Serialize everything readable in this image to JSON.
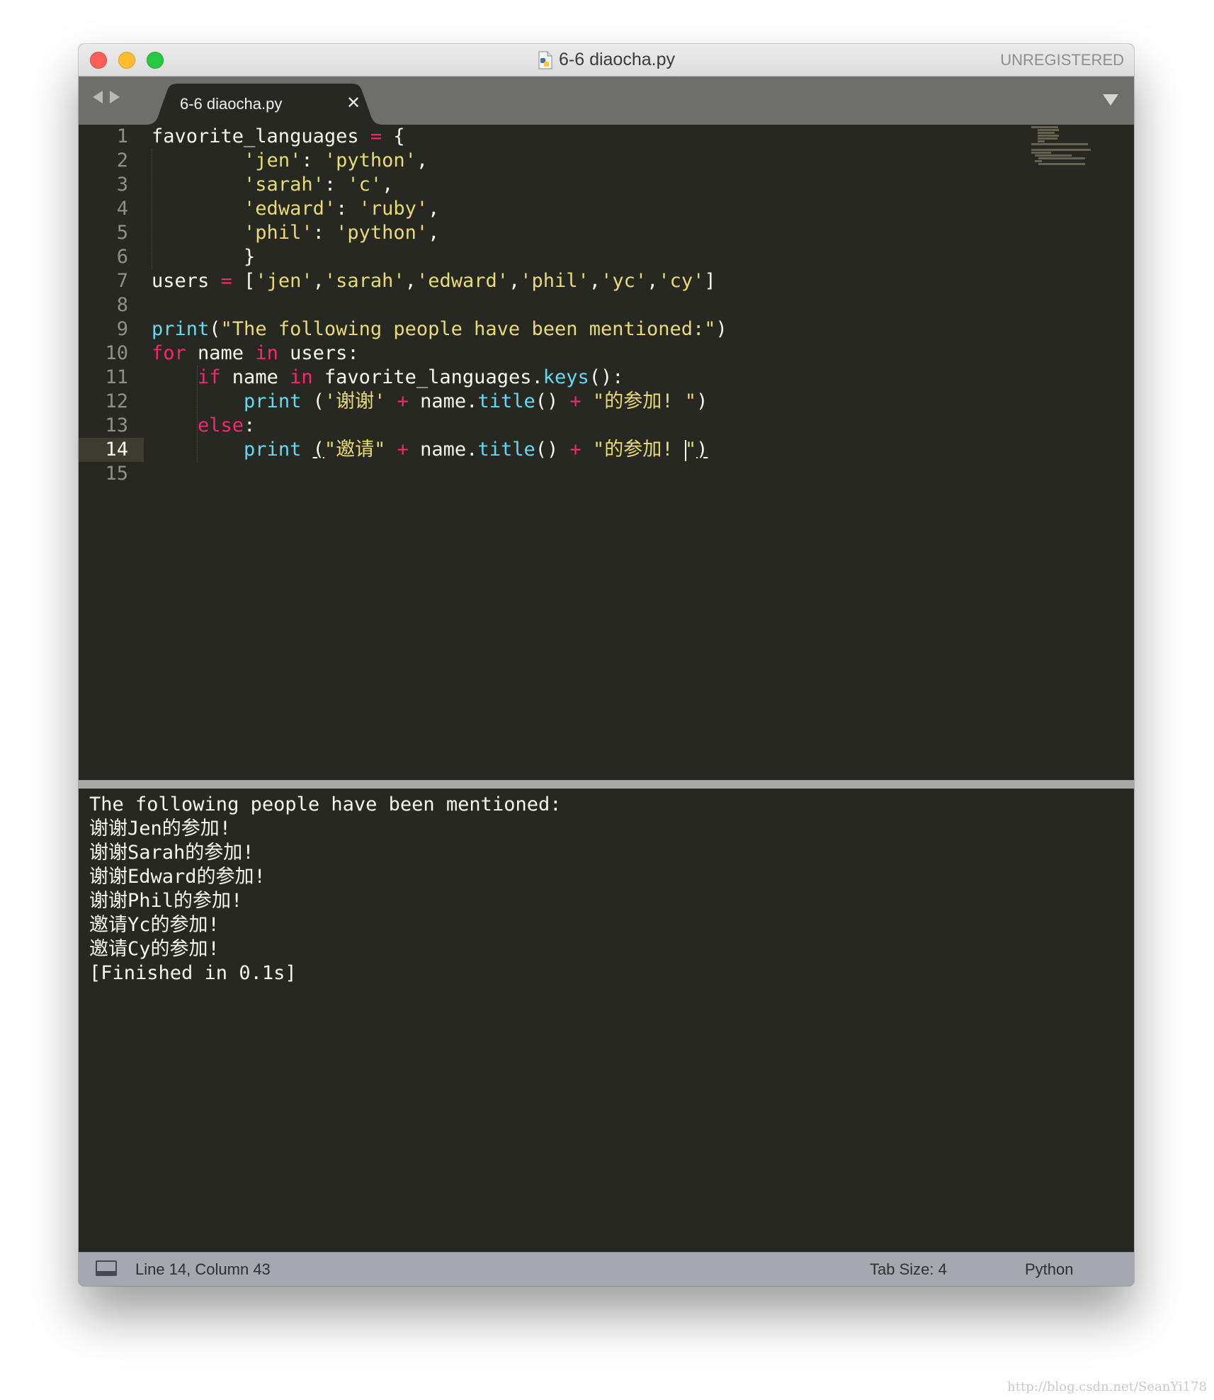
{
  "window": {
    "title": "6-6 diaocha.py",
    "registration": "UNREGISTERED"
  },
  "tabs": [
    {
      "label": "6-6 diaocha.py",
      "close_glyph": "✕",
      "active": true
    }
  ],
  "icons": {
    "file": "python-file-icon",
    "nav_back": "arrow-left-icon",
    "nav_forward": "arrow-right-icon",
    "tab_close": "close-icon",
    "tab_menu": "triangle-down-icon",
    "panel_toggle": "panel-icon"
  },
  "editor": {
    "line_numbers": [
      "1",
      "2",
      "3",
      "4",
      "5",
      "6",
      "7",
      "8",
      "9",
      "10",
      "11",
      "12",
      "13",
      "14",
      "15"
    ],
    "active_line": 14,
    "lines": [
      [
        {
          "t": "favorite_languages ",
          "c": "p"
        },
        {
          "t": "=",
          "c": "op"
        },
        {
          "t": " {",
          "c": "p"
        }
      ],
      [
        {
          "t": "        ",
          "c": "p"
        },
        {
          "t": "'jen'",
          "c": "str"
        },
        {
          "t": ": ",
          "c": "p"
        },
        {
          "t": "'python'",
          "c": "str"
        },
        {
          "t": ",",
          "c": "p"
        }
      ],
      [
        {
          "t": "        ",
          "c": "p"
        },
        {
          "t": "'sarah'",
          "c": "str"
        },
        {
          "t": ": ",
          "c": "p"
        },
        {
          "t": "'c'",
          "c": "str"
        },
        {
          "t": ",",
          "c": "p"
        }
      ],
      [
        {
          "t": "        ",
          "c": "p"
        },
        {
          "t": "'edward'",
          "c": "str"
        },
        {
          "t": ": ",
          "c": "p"
        },
        {
          "t": "'ruby'",
          "c": "str"
        },
        {
          "t": ",",
          "c": "p"
        }
      ],
      [
        {
          "t": "        ",
          "c": "p"
        },
        {
          "t": "'phil'",
          "c": "str"
        },
        {
          "t": ": ",
          "c": "p"
        },
        {
          "t": "'python'",
          "c": "str"
        },
        {
          "t": ",",
          "c": "p"
        }
      ],
      [
        {
          "t": "        }",
          "c": "p"
        }
      ],
      [
        {
          "t": "users ",
          "c": "p"
        },
        {
          "t": "=",
          "c": "op"
        },
        {
          "t": " [",
          "c": "p"
        },
        {
          "t": "'jen'",
          "c": "str"
        },
        {
          "t": ",",
          "c": "p"
        },
        {
          "t": "'sarah'",
          "c": "str"
        },
        {
          "t": ",",
          "c": "p"
        },
        {
          "t": "'edward'",
          "c": "str"
        },
        {
          "t": ",",
          "c": "p"
        },
        {
          "t": "'phil'",
          "c": "str"
        },
        {
          "t": ",",
          "c": "p"
        },
        {
          "t": "'yc'",
          "c": "str"
        },
        {
          "t": ",",
          "c": "p"
        },
        {
          "t": "'cy'",
          "c": "str"
        },
        {
          "t": "]",
          "c": "p"
        }
      ],
      [],
      [
        {
          "t": "print",
          "c": "fn"
        },
        {
          "t": "(",
          "c": "p"
        },
        {
          "t": "\"The following people have been mentioned:\"",
          "c": "str"
        },
        {
          "t": ")",
          "c": "p"
        }
      ],
      [
        {
          "t": "for",
          "c": "kw"
        },
        {
          "t": " name ",
          "c": "p"
        },
        {
          "t": "in",
          "c": "kw"
        },
        {
          "t": " users:",
          "c": "p"
        }
      ],
      [
        {
          "t": "    ",
          "c": "p"
        },
        {
          "t": "if",
          "c": "kw"
        },
        {
          "t": " name ",
          "c": "p"
        },
        {
          "t": "in",
          "c": "kw"
        },
        {
          "t": " favorite_languages.",
          "c": "p"
        },
        {
          "t": "keys",
          "c": "fn"
        },
        {
          "t": "():",
          "c": "p"
        }
      ],
      [
        {
          "t": "        ",
          "c": "p"
        },
        {
          "t": "print",
          "c": "fn"
        },
        {
          "t": " (",
          "c": "p"
        },
        {
          "t": "'谢谢'",
          "c": "str"
        },
        {
          "t": " ",
          "c": "p"
        },
        {
          "t": "+",
          "c": "op"
        },
        {
          "t": " name.",
          "c": "p"
        },
        {
          "t": "title",
          "c": "fn"
        },
        {
          "t": "() ",
          "c": "p"
        },
        {
          "t": "+",
          "c": "op"
        },
        {
          "t": " ",
          "c": "p"
        },
        {
          "t": "\"的参加! \"",
          "c": "str"
        },
        {
          "t": ")",
          "c": "p"
        }
      ],
      [
        {
          "t": "    ",
          "c": "p"
        },
        {
          "t": "else",
          "c": "kw"
        },
        {
          "t": ":",
          "c": "p"
        }
      ],
      [
        {
          "t": "        ",
          "c": "p"
        },
        {
          "t": "print",
          "c": "fn"
        },
        {
          "t": " ",
          "c": "p"
        },
        {
          "t": "(",
          "c": "bu"
        },
        {
          "t": "\"邀请\"",
          "c": "str"
        },
        {
          "t": " ",
          "c": "p"
        },
        {
          "t": "+",
          "c": "op"
        },
        {
          "t": " name.",
          "c": "p"
        },
        {
          "t": "title",
          "c": "fn"
        },
        {
          "t": "() ",
          "c": "p"
        },
        {
          "t": "+",
          "c": "op"
        },
        {
          "t": " ",
          "c": "p"
        },
        {
          "t": "\"的参加! ",
          "c": "str"
        },
        {
          "t": "",
          "c": "cursor"
        },
        {
          "t": "\"",
          "c": "str"
        },
        {
          "t": ")",
          "c": "bu"
        }
      ],
      []
    ]
  },
  "output": {
    "lines": [
      "The following people have been mentioned:",
      "谢谢Jen的参加!",
      "谢谢Sarah的参加!",
      "谢谢Edward的参加!",
      "谢谢Phil的参加!",
      "邀请Yc的参加!",
      "邀请Cy的参加!",
      "[Finished in 0.1s]"
    ]
  },
  "status": {
    "position": "Line 14, Column 43",
    "tab_size": "Tab Size: 4",
    "syntax": "Python"
  },
  "watermark": "http://blog.csdn.net/SeanYi178",
  "colors": {
    "editor_bg": "#272822",
    "keyword": "#f92672",
    "function": "#66d9ef",
    "string": "#e6db74",
    "plain": "#f8f8f2",
    "gutter": "#8f908a",
    "status_bg": "#a5a8ae",
    "tabbar_bg": "#6e6f6b"
  }
}
